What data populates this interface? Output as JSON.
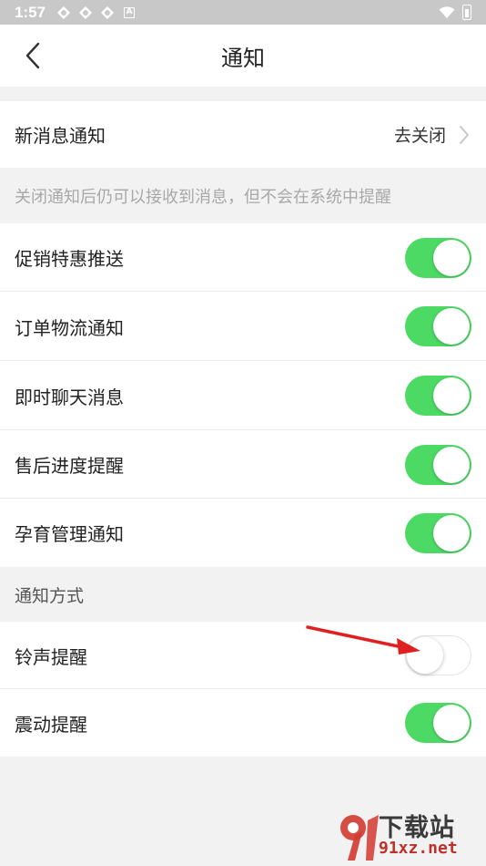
{
  "status_bar": {
    "time": "1:57",
    "a_badge": "A"
  },
  "header": {
    "title": "通知"
  },
  "new_message": {
    "label": "新消息通知",
    "value": "去关闭"
  },
  "hint": "关闭通知后仍可以接收到消息，但不会在系统中提醒",
  "toggles": [
    {
      "label": "促销特惠推送",
      "on": true
    },
    {
      "label": "订单物流通知",
      "on": true
    },
    {
      "label": "即时聊天消息",
      "on": true
    },
    {
      "label": "售后进度提醒",
      "on": true
    },
    {
      "label": "孕育管理通知",
      "on": true
    }
  ],
  "method_section": {
    "title": "通知方式",
    "items": [
      {
        "label": "铃声提醒",
        "on": false
      },
      {
        "label": "震动提醒",
        "on": true
      }
    ]
  },
  "watermark": {
    "brand": "下载站",
    "site": "91xz.net"
  },
  "colors": {
    "toggle_on": "#4cd964",
    "arrow": "#e02020",
    "status_bar": "#c8c8c8"
  }
}
